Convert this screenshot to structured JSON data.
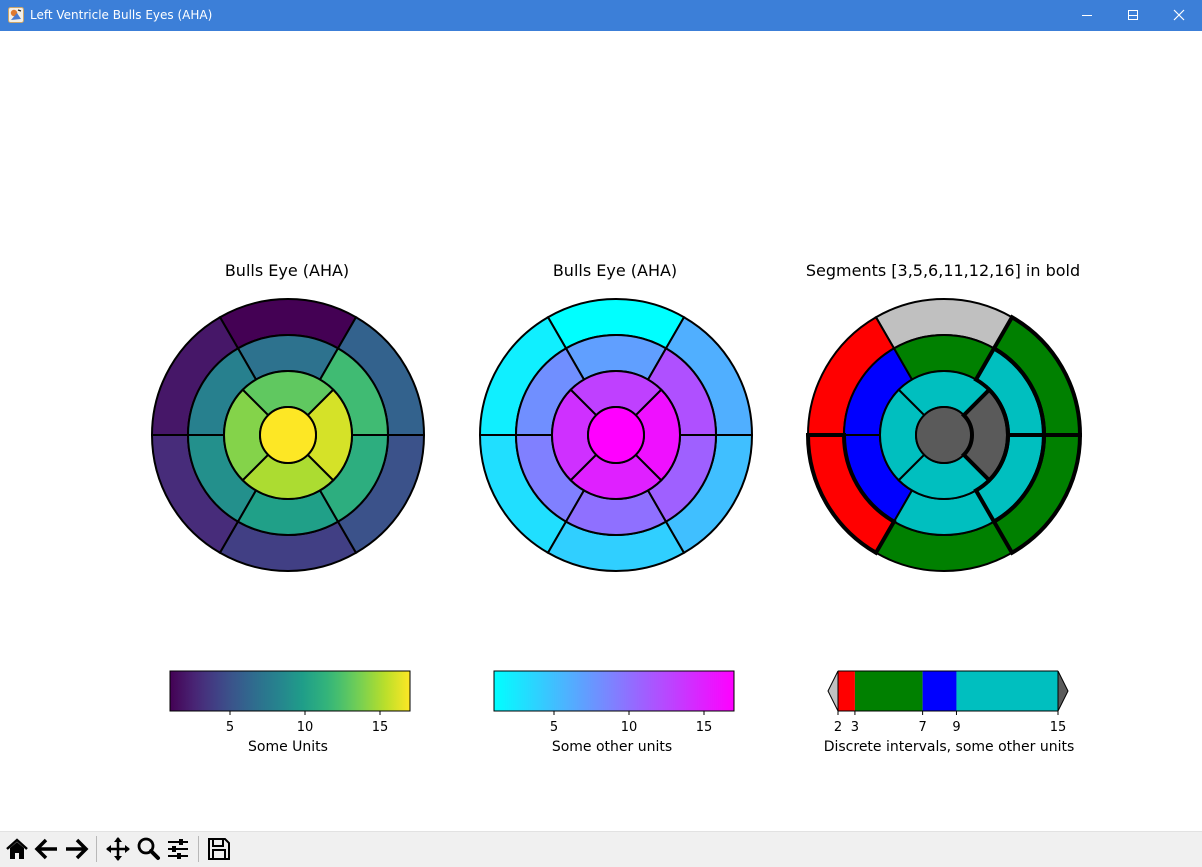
{
  "window": {
    "title": "Left Ventricle Bulls Eyes (AHA)",
    "controls": [
      "minimize-icon",
      "maximize-icon",
      "close-icon"
    ]
  },
  "toolbar": {
    "buttons": [
      "home-icon",
      "back-icon",
      "forward-icon",
      "pan-icon",
      "zoom-icon",
      "configure-subplots-icon",
      "save-icon"
    ]
  },
  "chart_data": [
    {
      "type": "bullseye",
      "title": "Bulls Eye (AHA)",
      "segments": [
        1,
        2,
        3,
        4,
        5,
        6,
        7,
        8,
        9,
        10,
        11,
        12,
        13,
        14,
        15,
        16,
        17
      ],
      "values": [
        1,
        2,
        3,
        4,
        5,
        6,
        7,
        8,
        9,
        10,
        11,
        12,
        13,
        14,
        15,
        16,
        17
      ],
      "colormap": "viridis",
      "norm": [
        1,
        17
      ],
      "bold_segments": [],
      "colorbar": {
        "label": "Some Units",
        "ticks": [
          5,
          10,
          15
        ],
        "tick_labels": [
          "5",
          "10",
          "15"
        ],
        "range": [
          1,
          17
        ]
      }
    },
    {
      "type": "bullseye",
      "title": "Bulls Eye (AHA)",
      "segments": [
        1,
        2,
        3,
        4,
        5,
        6,
        7,
        8,
        9,
        10,
        11,
        12,
        13,
        14,
        15,
        16,
        17
      ],
      "values": [
        1,
        2,
        3,
        4,
        5,
        6,
        7,
        8,
        9,
        10,
        11,
        12,
        13,
        14,
        15,
        16,
        17
      ],
      "colormap": "cool",
      "norm": [
        1,
        17
      ],
      "bold_segments": [],
      "colorbar": {
        "label": "Some other units",
        "ticks": [
          5,
          10,
          15
        ],
        "tick_labels": [
          "5",
          "10",
          "15"
        ],
        "range": [
          1,
          17
        ]
      }
    },
    {
      "type": "bullseye",
      "title": "Segments [3,5,6,11,12,16] in bold",
      "segments": [
        1,
        2,
        3,
        4,
        5,
        6,
        7,
        8,
        9,
        10,
        11,
        12,
        13,
        14,
        15,
        16,
        17
      ],
      "values": [
        1,
        2,
        3,
        4,
        5,
        6,
        7,
        8,
        9,
        10,
        11,
        12,
        13,
        14,
        15,
        16,
        17
      ],
      "colormap": "discrete",
      "bold_segments": [
        3,
        5,
        6,
        11,
        12,
        16
      ],
      "colorbar": {
        "label": "Discrete intervals, some other units",
        "ticks": [
          2,
          3,
          7,
          9,
          15
        ],
        "tick_labels": [
          "2",
          "3",
          "7",
          "9",
          "15"
        ],
        "range": [
          2,
          15
        ],
        "intervals": [
          {
            "from": 2,
            "to": 3,
            "color": "#ff0000"
          },
          {
            "from": 3,
            "to": 7,
            "color": "#008000"
          },
          {
            "from": 7,
            "to": 9,
            "color": "#0000ff"
          },
          {
            "from": 9,
            "to": 15,
            "color": "#00bfbf"
          }
        ],
        "under_color": "#c0c0c0",
        "over_color": "#5a5a5a"
      }
    }
  ]
}
